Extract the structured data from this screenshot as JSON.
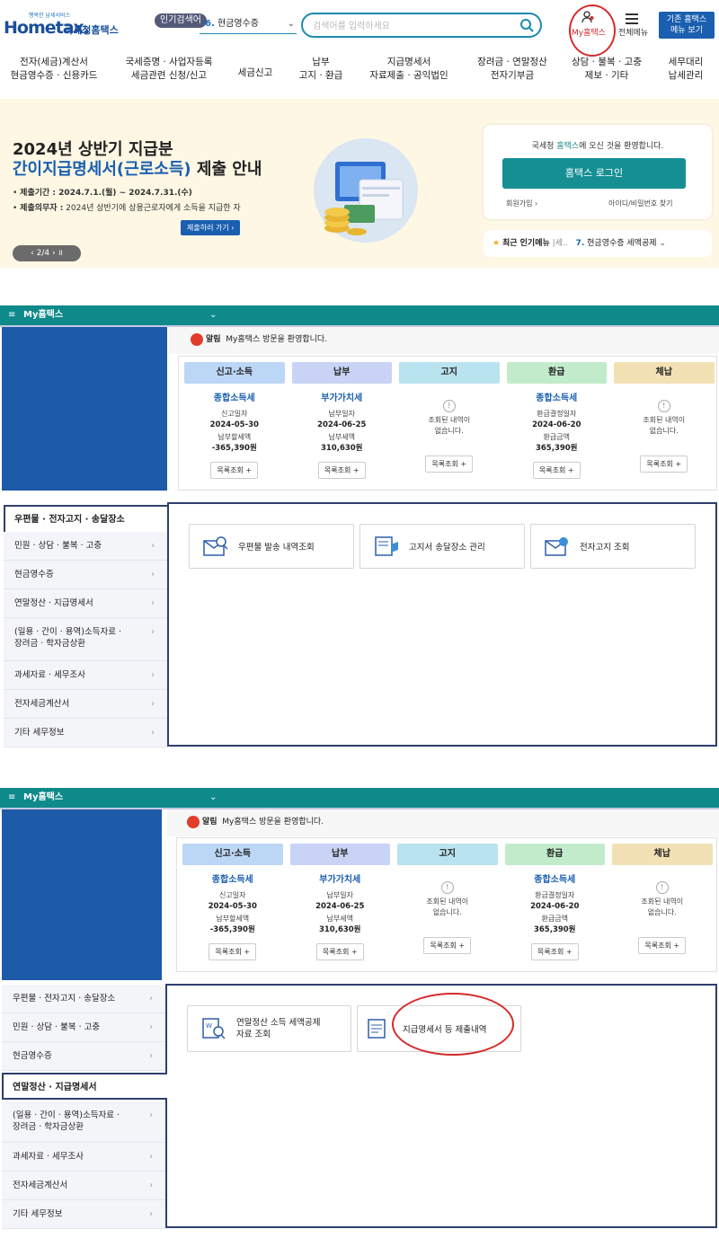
{
  "header": {
    "logo_small": "행복한 납세서비스",
    "logo_main": "Hometax.",
    "logo_sub": "국세청홈택스",
    "popular_badge": "인기검색어",
    "popular_num": "6.",
    "popular_term": "현금영수증",
    "search_placeholder": "검색어를 입력하세요",
    "my_label": "My홈택스",
    "menu_label": "전체메뉴",
    "old_btn": "기존 홈택스\n메뉴 보기"
  },
  "nav": [
    {
      "l1": "전자(세금)계산서",
      "l2": "현금영수증 · 신용카드"
    },
    {
      "l1": "국세증명 · 사업자등록",
      "l2": "세금관련 신청/신고"
    },
    {
      "l1": "세금신고",
      "l2": ""
    },
    {
      "l1": "납부",
      "l2": "고지 · 환급"
    },
    {
      "l1": "지급명세서",
      "l2": "자료제출 · 공익법인"
    },
    {
      "l1": "장려금 · 연말정산",
      "l2": "전자기부금"
    },
    {
      "l1": "상담 · 불복 · 고충",
      "l2": "제보 · 기타"
    },
    {
      "l1": "세무대리",
      "l2": "납세관리"
    }
  ],
  "banner": {
    "title1": "2024년 상반기 지급분",
    "title2a": "간이지급명세서(근로소득)",
    "title2b": " 제출 안내",
    "period_label": "제출기간 :",
    "period": " 2024.7.1.(월) ~ 2024.7.31.(수)",
    "duty_label": "제출의무자 :",
    "duty": " 2024년 상반기에 상용근로자에게 소득을 지급한 자",
    "button": "제출하러 가기 ›",
    "pager": "‹  2/4  ›   ॥"
  },
  "login": {
    "welcome_a": "국세청 ",
    "welcome_b": "홈택스",
    "welcome_c": "에 오신 것을 환영합니다.",
    "button": "홈택스 로그인",
    "join": "회원가입 ›",
    "find": "아이디/비밀번호 찾기"
  },
  "hot": {
    "label": "최근 인기메뉴",
    "prev": "|세..",
    "num": "7.",
    "item": "현금영수증 세액공제"
  },
  "panel": {
    "ham": "≡",
    "title": "My홈택스",
    "chev": "⌄",
    "notice_label": "알림",
    "notice_text": "My홈택스 방문을 환영합니다."
  },
  "stats": [
    {
      "head": "신고·소득",
      "color": "#bcd6f5",
      "main": "종합소득세",
      "sub1": "신고일자",
      "val1": "2024-05-30",
      "sub2": "납부할세액",
      "val2": "-365,390원",
      "btn": "목록조회 +"
    },
    {
      "head": "납부",
      "color": "#c8d3f5",
      "main": "부가가치세",
      "sub1": "납부일자",
      "val1": "2024-06-25",
      "sub2": "납부세액",
      "val2": "310,630원",
      "btn": "목록조회 +"
    },
    {
      "head": "고지",
      "color": "#b9e3ef",
      "main": "",
      "sub1": "조회된 내역이",
      "val1": "",
      "sub2": "없습니다.",
      "val2": "",
      "btn": "목록조회 +"
    },
    {
      "head": "환급",
      "color": "#c2ebcc",
      "main": "종합소득세",
      "sub1": "환급결정일자",
      "val1": "2024-06-20",
      "sub2": "환급금액",
      "val2": "365,390원",
      "btn": "목록조회 +"
    },
    {
      "head": "체납",
      "color": "#f2e1b4",
      "main": "",
      "sub1": "조회된 내역이",
      "val1": "",
      "sub2": "없습니다.",
      "val2": "",
      "btn": "목록조회 +"
    }
  ],
  "sidebar": {
    "s1_head": "우편물 · 전자고지 · 송달장소",
    "items1": [
      "민원 · 상담 · 불복 · 고충",
      "현금영수증",
      "연말정산 · 지급명세서",
      "(일용 · 간이 · 용역)소득자료 ·\n장려금 · 학자금상환",
      "과세자료 · 세무조사",
      "전자세금계산서",
      "기타 세무정보"
    ],
    "s2_head": "연말정산 · 지급명세서",
    "items2_top": [
      "우편물 · 전자고지 · 송달장소",
      "민원 · 상담 · 불복 · 고충",
      "현금영수증"
    ],
    "items2_bottom": [
      "(일용 · 간이 · 용역)소득자료 ·\n장려금 · 학자금상환",
      "과세자료 · 세무조사",
      "전자세금계산서",
      "기타 세무정보"
    ]
  },
  "cards1": [
    "우편물 발송 내역조회",
    "고지서 송달장소 관리",
    "전자고지 조회"
  ],
  "cards2": [
    "연말정산 소득 세액공제\n자료 조회",
    "지급명세서 등 제출내역"
  ]
}
